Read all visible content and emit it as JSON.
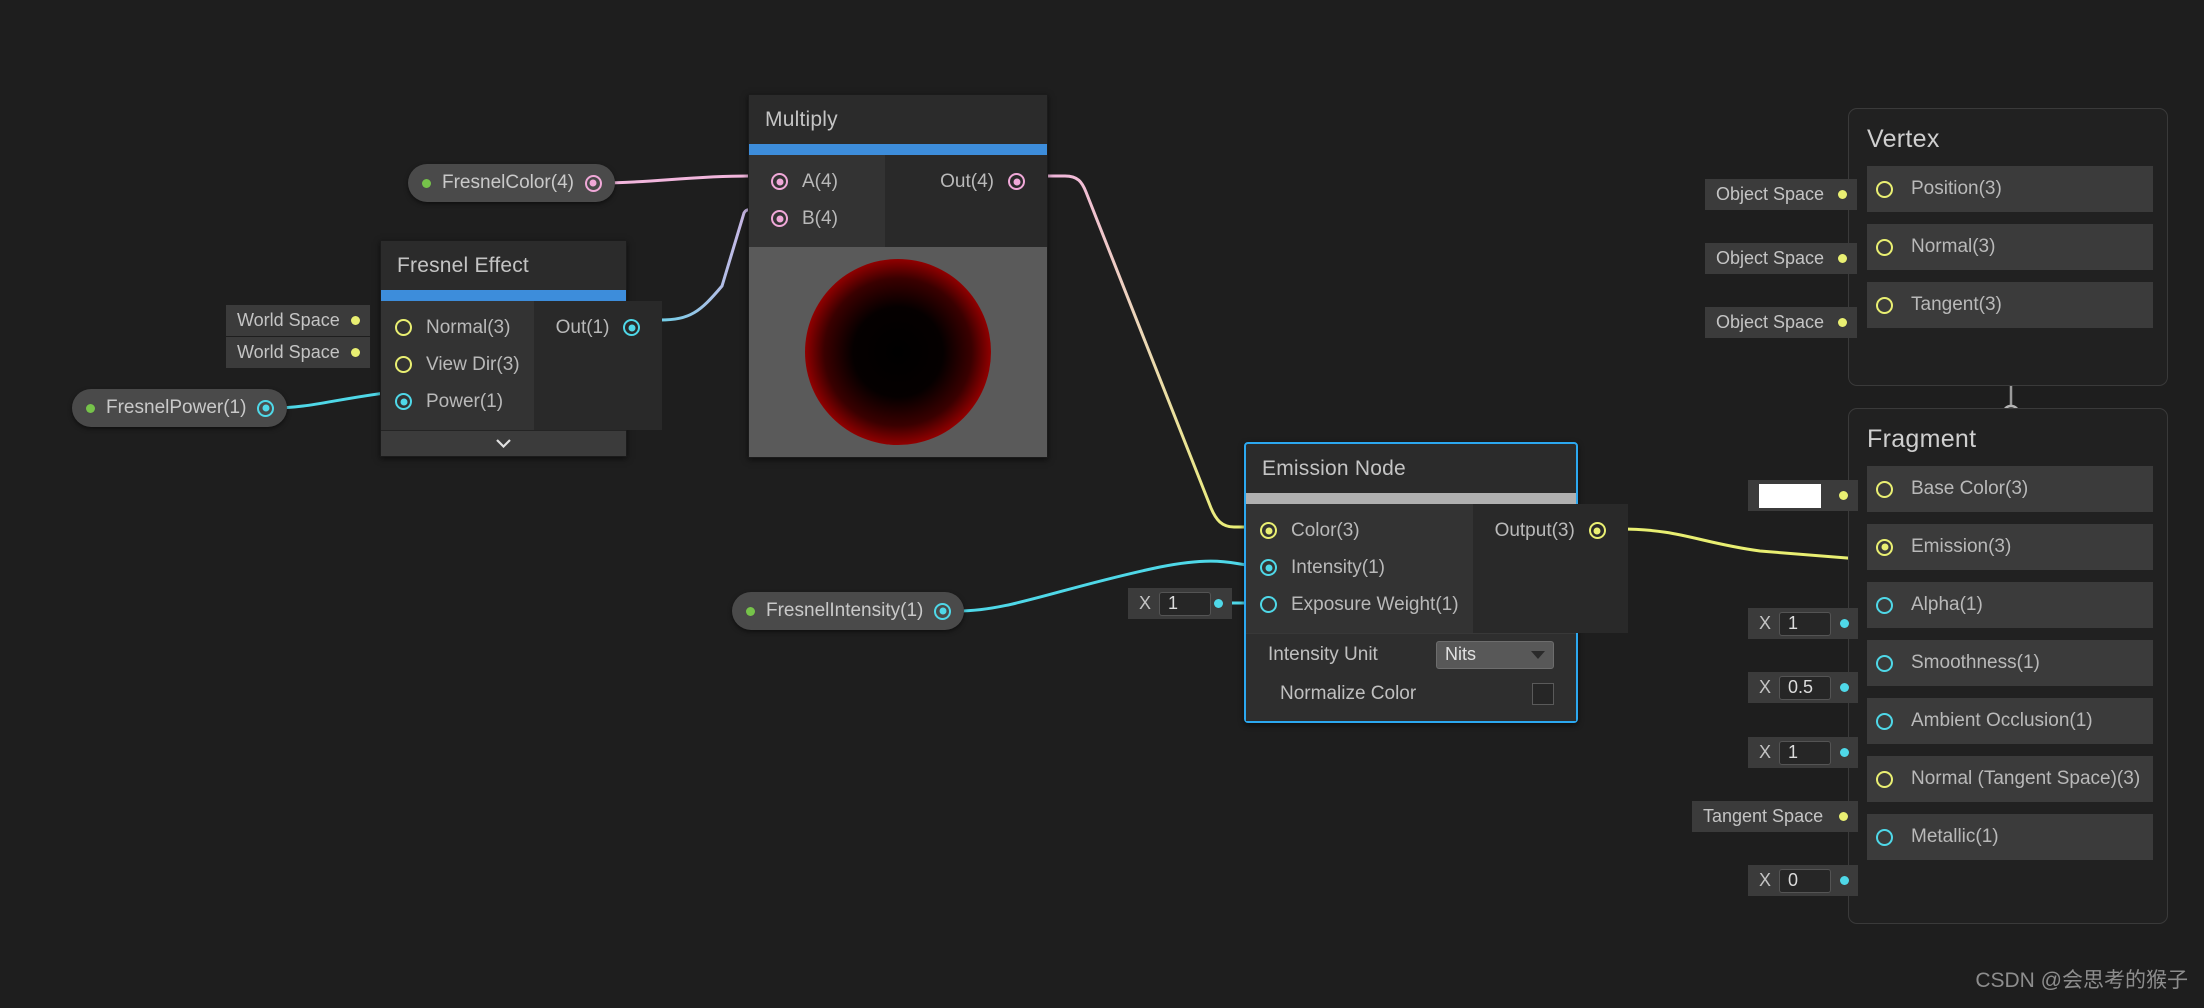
{
  "app": {
    "background": "#1e1e1e",
    "accent_blue": "#3d8ddb",
    "selection_blue": "#2ca8f0"
  },
  "watermark": {
    "text": "CSDN @会思考的猴子"
  },
  "properties": [
    {
      "name": "fresnel-color",
      "label": "FresnelColor(4)",
      "port_color": "pink"
    },
    {
      "name": "fresnel-power",
      "label": "FresnelPower(1)",
      "port_color": "cyan"
    },
    {
      "name": "fresnel-intensity",
      "label": "FresnelIntensity(1)",
      "port_color": "cyan"
    }
  ],
  "nodes": {
    "multiply": {
      "title": "Multiply",
      "accent": "#3d8ddb",
      "inputs": [
        {
          "label": "A(4)",
          "color": "pink",
          "filled": true
        },
        {
          "label": "B(4)",
          "color": "pink",
          "filled": true
        }
      ],
      "outputs": [
        {
          "label": "Out(4)",
          "color": "pink",
          "filled": true
        }
      ],
      "preview": {
        "type": "fresnel-sphere",
        "inner": "#000000",
        "outer": "#ff0000",
        "bg": "#5a5a5a"
      }
    },
    "fresnel_effect": {
      "title": "Fresnel Effect",
      "accent": "#3d8ddb",
      "inputs": [
        {
          "label": "Normal(3)",
          "color": "yellow",
          "filled": false,
          "control": "World Space"
        },
        {
          "label": "View Dir(3)",
          "color": "yellow",
          "filled": false,
          "control": "World Space"
        },
        {
          "label": "Power(1)",
          "color": "cyan",
          "filled": true
        }
      ],
      "outputs": [
        {
          "label": "Out(1)",
          "color": "cyan",
          "filled": true
        }
      ],
      "collapse_icon": "chevron-down-icon"
    },
    "emission": {
      "title": "Emission Node",
      "accent": "#b0b0b0",
      "selected": true,
      "inputs": [
        {
          "label": "Color(3)",
          "color": "yellow",
          "filled": true
        },
        {
          "label": "Intensity(1)",
          "color": "cyan",
          "filled": true
        },
        {
          "label": "Exposure Weight(1)",
          "color": "cyan",
          "filled": false
        }
      ],
      "outputs": [
        {
          "label": "Output(3)",
          "color": "yellow",
          "filled": true
        }
      ],
      "settings": [
        {
          "label": "Intensity Unit",
          "type": "dropdown",
          "value": "Nits"
        },
        {
          "label": "Normalize Color",
          "type": "checkbox",
          "value": false
        }
      ]
    }
  },
  "stacks": {
    "vertex": {
      "title": "Vertex",
      "rows": [
        {
          "label": "Position(3)",
          "color": "yellow",
          "filled": false,
          "control": {
            "type": "enum",
            "value": "Object Space",
            "dot": "yellow"
          }
        },
        {
          "label": "Normal(3)",
          "color": "yellow",
          "filled": false,
          "control": {
            "type": "enum",
            "value": "Object Space",
            "dot": "yellow"
          }
        },
        {
          "label": "Tangent(3)",
          "color": "yellow",
          "filled": false,
          "control": {
            "type": "enum",
            "value": "Object Space",
            "dot": "yellow"
          }
        }
      ]
    },
    "fragment": {
      "title": "Fragment",
      "rows": [
        {
          "label": "Base Color(3)",
          "color": "yellow",
          "filled": false,
          "control": {
            "type": "color",
            "value": "#ffffff",
            "dot": "yellow"
          }
        },
        {
          "label": "Emission(3)",
          "color": "yellow",
          "filled": true,
          "control": null
        },
        {
          "label": "Alpha(1)",
          "color": "cyan",
          "filled": false,
          "control": {
            "type": "float",
            "axis": "X",
            "value": "1",
            "dot": "cyan"
          }
        },
        {
          "label": "Smoothness(1)",
          "color": "cyan",
          "filled": false,
          "control": {
            "type": "float",
            "axis": "X",
            "value": "0.5",
            "dot": "cyan"
          }
        },
        {
          "label": "Ambient Occlusion(1)",
          "color": "cyan",
          "filled": false,
          "control": {
            "type": "float",
            "axis": "X",
            "value": "1",
            "dot": "cyan"
          }
        },
        {
          "label": "Normal (Tangent Space)(3)",
          "color": "yellow",
          "filled": false,
          "control": {
            "type": "enum",
            "value": "Tangent Space",
            "dot": "yellow"
          }
        },
        {
          "label": "Metallic(1)",
          "color": "cyan",
          "filled": false,
          "control": {
            "type": "float",
            "axis": "X",
            "value": "0",
            "dot": "cyan"
          }
        }
      ]
    }
  },
  "standalone_controls": [
    {
      "name": "exposure-weight-float",
      "axis": "X",
      "value": "1",
      "dot": "cyan"
    }
  ],
  "edges": [
    {
      "from": "fresnel-color",
      "to": "multiply.A(4)",
      "color_start": "#f2b6dd",
      "color_end": "#f2b6dd"
    },
    {
      "from": "fresnel-power",
      "to": "fresnel-effect.Power(1)",
      "color_start": "#4fd8e8",
      "color_end": "#4fd8e8"
    },
    {
      "from": "fresnel-effect.Out(1)",
      "to": "multiply.B(4)",
      "color_start": "#4fd8e8",
      "color_end": "#d8b6e8"
    },
    {
      "from": "multiply.Out(4)",
      "to": "emission.Color(3)",
      "color_start": "#f2b6dd",
      "color_end": "#e9ef72"
    },
    {
      "from": "fresnel-intensity",
      "to": "emission.Intensity(1)",
      "color_start": "#4fd8e8",
      "color_end": "#4fd8e8"
    },
    {
      "from": "emission.Output(3)",
      "to": "fragment.Emission(3)",
      "color_start": "#e9ef72",
      "color_end": "#e9ef72"
    }
  ]
}
